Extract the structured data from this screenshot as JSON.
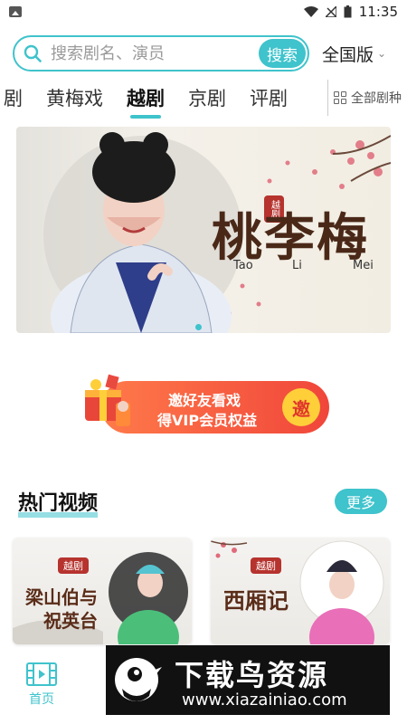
{
  "status_bar": {
    "time": "11:35"
  },
  "search": {
    "placeholder": "搜索剧名、演员",
    "button_label": "搜索"
  },
  "region": {
    "label": "全国版"
  },
  "tabs": [
    {
      "label": "剧",
      "active": false
    },
    {
      "label": "黄梅戏",
      "active": false
    },
    {
      "label": "越剧",
      "active": true
    },
    {
      "label": "京剧",
      "active": false
    },
    {
      "label": "评剧",
      "active": false
    }
  ],
  "all_categories": {
    "label": "全部剧种"
  },
  "banner": {
    "tag": "越剧",
    "title": "桃李梅",
    "pinyin": [
      "Tao",
      "Li",
      "Mei"
    ]
  },
  "invite": {
    "line1": "邀好友看戏",
    "line2": "得VIP会员权益",
    "coin": "邀"
  },
  "hot_section": {
    "title": "热门视频",
    "more_label": "更多"
  },
  "videos": [
    {
      "badge": "越剧",
      "title_line1": "梁山伯与",
      "title_line2": "祝英台"
    },
    {
      "badge": "越剧",
      "title_line1": "西厢记",
      "title_line2": ""
    }
  ],
  "bottom_nav": {
    "home_label": "首页"
  },
  "watermark": {
    "title": "下载鸟资源",
    "url": "www.xiazainiao.com"
  },
  "colors": {
    "accent": "#3fc3cc",
    "badge_red": "#b6332e",
    "invite_orange": "#f0463a"
  }
}
